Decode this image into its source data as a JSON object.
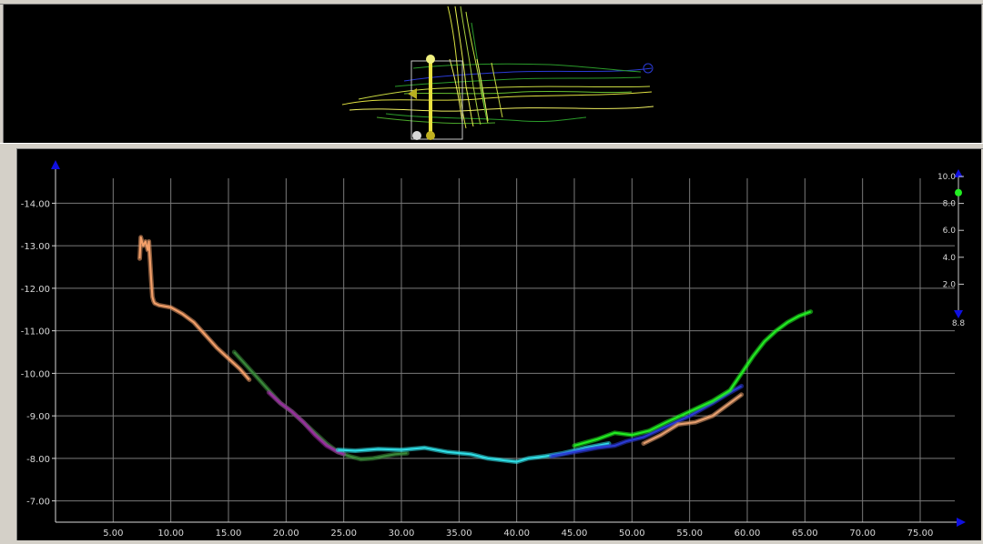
{
  "chart_data": {
    "type": "line",
    "title": "",
    "xlabel": "",
    "ylabel": "",
    "xlim": [
      0,
      78
    ],
    "ylim": [
      -6.5,
      -14.8
    ],
    "x_ticks": [
      "5.00",
      "10.00",
      "15.00",
      "20.00",
      "25.00",
      "30.00",
      "35.00",
      "40.00",
      "45.00",
      "50.00",
      "55.00",
      "60.00",
      "65.00",
      "70.00",
      "75.00"
    ],
    "y_ticks": [
      "-7.00",
      "-8.00",
      "-9.00",
      "-10.00",
      "-11.00",
      "-12.00",
      "-13.00",
      "-14.00"
    ],
    "grid": true,
    "series": [
      {
        "color": "#f4a06a",
        "x": [
          7.3,
          7.4,
          7.6,
          7.8,
          8.0,
          8.1,
          8.3,
          8.4,
          8.5,
          8.6,
          9.0,
          10.0,
          11.0,
          12.0,
          13.0,
          14.0,
          15.0,
          16.0,
          16.8
        ],
        "y": [
          -12.7,
          -13.2,
          -13.0,
          -13.1,
          -12.9,
          -13.1,
          -12.2,
          -11.8,
          -11.7,
          -11.65,
          -11.6,
          -11.55,
          -11.4,
          -11.2,
          -10.9,
          -10.6,
          -10.35,
          -10.1,
          -9.85
        ]
      },
      {
        "color": "#3a8a3a",
        "x": [
          15.5,
          16.5,
          17.5,
          18.5,
          19.5,
          20.5,
          21.5,
          22.5,
          23.5,
          24.5,
          25.5,
          26.5,
          27.5,
          28.5,
          29.5,
          30.5
        ],
        "y": [
          -10.5,
          -10.2,
          -9.9,
          -9.6,
          -9.3,
          -9.1,
          -8.85,
          -8.6,
          -8.35,
          -8.15,
          -8.05,
          -7.98,
          -8.0,
          -8.05,
          -8.1,
          -8.12
        ]
      },
      {
        "color": "#9a2ca0",
        "x": [
          18.5,
          19.5,
          20.5,
          21.5,
          22.5,
          23.5,
          24.5,
          25.0
        ],
        "y": [
          -9.55,
          -9.3,
          -9.1,
          -8.85,
          -8.55,
          -8.3,
          -8.15,
          -8.1
        ]
      },
      {
        "color": "#2fe0e8",
        "x": [
          24.5,
          26.0,
          28.0,
          30.0,
          32.0,
          34.0,
          36.0,
          37.5,
          39.0,
          40.0,
          41.0,
          42.5,
          44.0,
          46.0,
          48.0
        ],
        "y": [
          -8.2,
          -8.18,
          -8.22,
          -8.2,
          -8.25,
          -8.15,
          -8.1,
          -8.0,
          -7.95,
          -7.92,
          -8.0,
          -8.05,
          -8.12,
          -8.25,
          -8.35
        ]
      },
      {
        "color": "#2b3bd6",
        "x": [
          43.0,
          45.0,
          47.0,
          48.5,
          49.5,
          51.0,
          53.0,
          55.0,
          57.0,
          58.5,
          59.5
        ],
        "y": [
          -8.05,
          -8.15,
          -8.25,
          -8.3,
          -8.4,
          -8.5,
          -8.75,
          -9.0,
          -9.3,
          -9.55,
          -9.7
        ]
      },
      {
        "color": "#22ee22",
        "x": [
          45.0,
          47.0,
          48.5,
          50.0,
          51.5,
          53.0,
          55.0,
          57.0,
          58.5,
          59.5,
          60.5,
          61.5,
          62.5,
          63.5,
          64.5,
          65.5
        ],
        "y": [
          -8.3,
          -8.45,
          -8.6,
          -8.55,
          -8.65,
          -8.85,
          -9.1,
          -9.35,
          -9.6,
          -10.0,
          -10.4,
          -10.75,
          -11.0,
          -11.2,
          -11.35,
          -11.45
        ]
      },
      {
        "color": "#e8a070",
        "x": [
          51.0,
          52.5,
          54.0,
          55.5,
          57.0,
          58.5,
          59.5
        ],
        "y": [
          -8.35,
          -8.55,
          -8.8,
          -8.85,
          -9.0,
          -9.3,
          -9.5
        ]
      }
    ],
    "scale_bar": {
      "ticks": [
        "10.0",
        "8.0",
        "6.0",
        "4.0",
        "2.0"
      ],
      "current_value": "8.8",
      "marker_value": 8.8
    }
  },
  "colors": {
    "background": "#000000",
    "grid": "#7a7a7a",
    "axis_text": "#d8d8d8",
    "axis_arrow": "#1010e0",
    "window_chrome": "#d4d0c8"
  }
}
